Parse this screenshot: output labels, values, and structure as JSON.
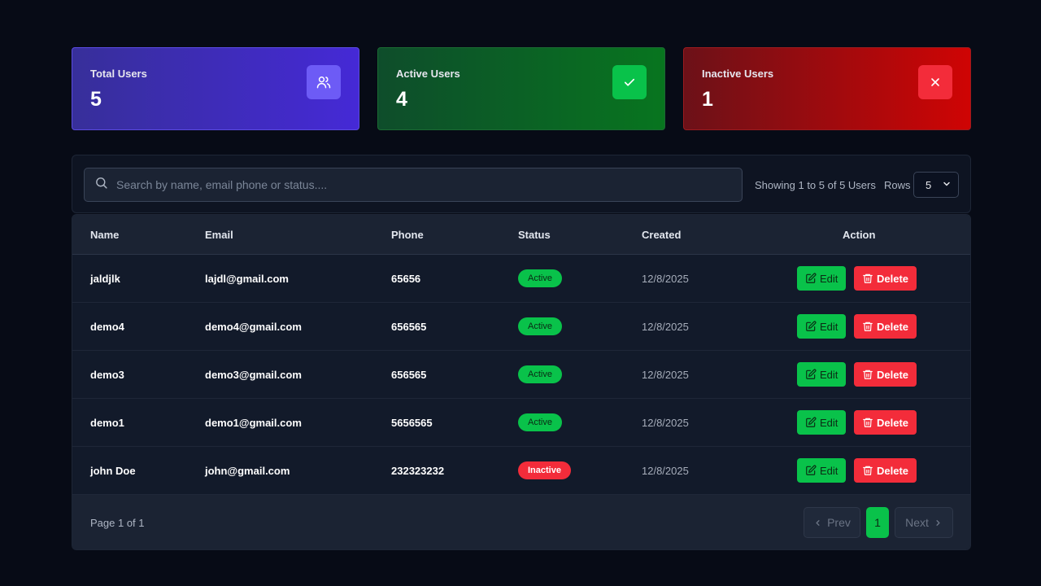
{
  "stats": [
    {
      "title": "Total Users",
      "value": "5",
      "icon": "users-icon",
      "color": "#4529d6"
    },
    {
      "title": "Active Users",
      "value": "4",
      "icon": "check-icon",
      "color": "#08751f"
    },
    {
      "title": "Inactive Users",
      "value": "1",
      "icon": "close-icon",
      "color": "#cf0404"
    }
  ],
  "search": {
    "placeholder": "Search by name, email phone or status...."
  },
  "showing_text": "Showing 1 to 5 of 5 Users",
  "rows_label": "Rows",
  "rows_value": "5",
  "columns": [
    "Name",
    "Email",
    "Phone",
    "Status",
    "Created",
    "Action"
  ],
  "users": [
    {
      "name": "jaldjlk",
      "email": "lajdl@gmail.com",
      "phone": "65656",
      "status": "Active",
      "created": "12/8/2025"
    },
    {
      "name": "demo4",
      "email": "demo4@gmail.com",
      "phone": "656565",
      "status": "Active",
      "created": "12/8/2025"
    },
    {
      "name": "demo3",
      "email": "demo3@gmail.com",
      "phone": "656565",
      "status": "Active",
      "created": "12/8/2025"
    },
    {
      "name": "demo1",
      "email": "demo1@gmail.com",
      "phone": "5656565",
      "status": "Active",
      "created": "12/8/2025"
    },
    {
      "name": "john Doe",
      "email": "john@gmail.com",
      "phone": "232323232",
      "status": "Inactive",
      "created": "12/8/2025"
    }
  ],
  "actions": {
    "edit": "Edit",
    "delete": "Delete"
  },
  "pagination": {
    "info": "Page 1 of 1",
    "prev": "Prev",
    "current": "1",
    "next": "Next"
  },
  "colors": {
    "active": "#09c24a",
    "inactive": "#f32c3a",
    "background": "#070b16"
  }
}
